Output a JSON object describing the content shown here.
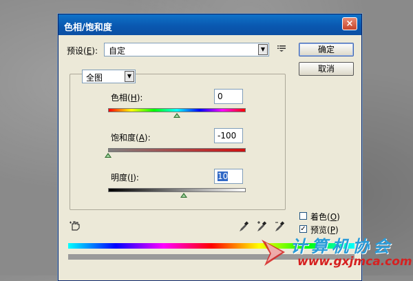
{
  "window": {
    "title": "色相/饱和度",
    "close_glyph": "×"
  },
  "preset": {
    "label_pre": "预设(",
    "label_key": "E",
    "label_post": "):",
    "value": "自定"
  },
  "buttons": {
    "ok": "确定",
    "cancel": "取消"
  },
  "channel": {
    "value": "全图"
  },
  "hue": {
    "label_pre": "色相(",
    "label_key": "H",
    "label_post": "):",
    "value": "0",
    "level_fraction": 0.5
  },
  "saturation": {
    "label_pre": "饱和度(",
    "label_key": "A",
    "label_post": "):",
    "value": "-100",
    "level_fraction": 0.0
  },
  "lightness": {
    "label_pre": "明度(",
    "label_key": "I",
    "label_post": "):",
    "value": "10",
    "level_fraction": 0.55
  },
  "colorize": {
    "label_pre": "着色(",
    "label_key": "O",
    "label_post": ")",
    "checked": false
  },
  "preview": {
    "label_pre": "预览(",
    "label_key": "P",
    "label_post": ")",
    "checked": true,
    "check_glyph": "✓"
  },
  "icons": {
    "hand_tool": "hand-adjust-icon",
    "eyedropper": "eyedropper-icon",
    "eyedropper_plus": "eyedropper-plus-icon",
    "eyedropper_minus": "eyedropper-minus-icon",
    "menu": "options-menu-icon"
  },
  "watermark": {
    "title": "计算机协会",
    "url": "www.gxjmca.com"
  },
  "colors": {
    "titlebar": "#0a58b0",
    "dialog_bg": "#ece9d8",
    "selection": "#3169c6",
    "saturation_end": "#d01010"
  }
}
